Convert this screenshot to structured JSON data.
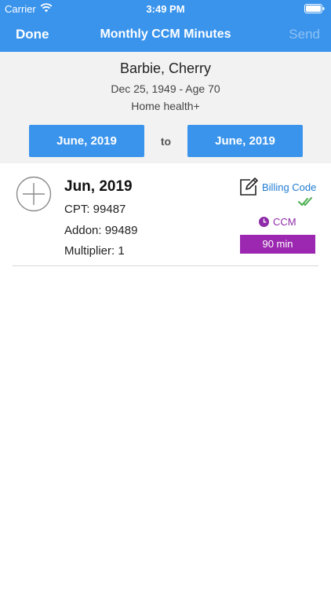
{
  "status_bar": {
    "carrier": "Carrier",
    "time": "3:49 PM"
  },
  "nav": {
    "done_label": "Done",
    "title": "Monthly CCM Minutes",
    "send_label": "Send"
  },
  "patient": {
    "name": "Barbie, Cherry",
    "dob_age": "Dec 25, 1949 - Age 70",
    "service": "Home health+"
  },
  "date_range": {
    "from": "June, 2019",
    "separator": "to",
    "to": "June, 2019"
  },
  "record": {
    "month": "Jun, 2019",
    "cpt": "CPT: 99487",
    "addon": "Addon: 99489",
    "multiplier": "Multiplier: 1",
    "billing_code_label": "Billing Code",
    "ccm_label": "CCM",
    "minutes": "90 min"
  },
  "icons": {
    "add": "plus-circle-icon",
    "edit": "edit-pencil-icon",
    "check": "double-check-icon",
    "clock": "clock-icon",
    "wifi": "wifi-icon",
    "battery": "battery-icon"
  },
  "colors": {
    "header": "#3a94ec",
    "button": "#3a94ec",
    "link": "#1f7bd3",
    "check": "#4caf50",
    "ccm": "#9c27b0",
    "send_disabled": "#8fc1f3"
  }
}
